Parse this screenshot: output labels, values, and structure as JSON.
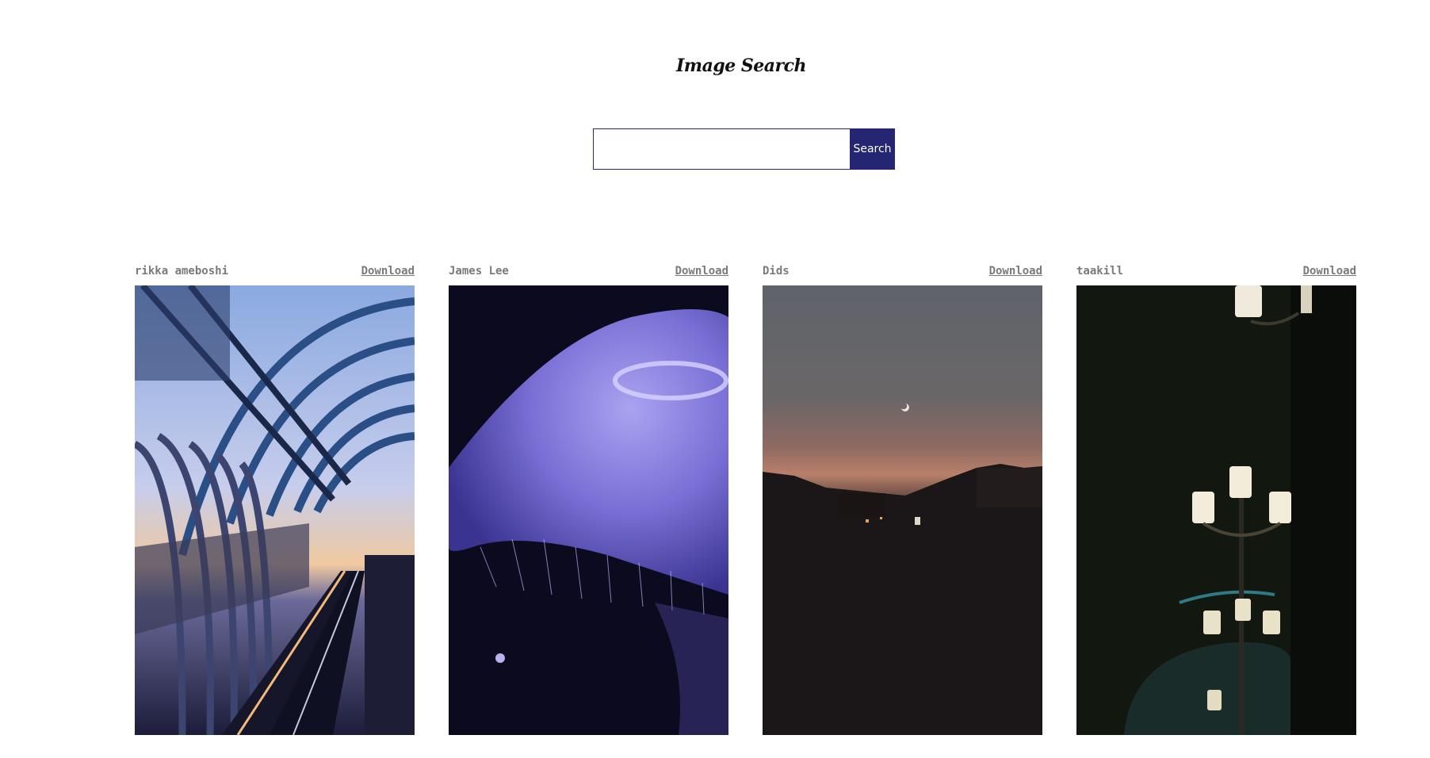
{
  "header": {
    "title": "Image Search"
  },
  "search": {
    "value": "",
    "placeholder": "",
    "button_label": "Search"
  },
  "results": [
    {
      "author": "rikka ameboshi",
      "download_label": "Download",
      "image_subject": "train station arched glass roof at dusk"
    },
    {
      "author": "James Lee",
      "download_label": "Download",
      "image_subject": "purple jellyfish"
    },
    {
      "author": "Dids",
      "download_label": "Download",
      "image_subject": "crescent moon over rooftops at sunset"
    },
    {
      "author": "taakill",
      "download_label": "Download",
      "image_subject": "vintage street lamps at night"
    }
  ],
  "colors": {
    "accent": "#242673",
    "meta_text": "#7a7a7a"
  }
}
